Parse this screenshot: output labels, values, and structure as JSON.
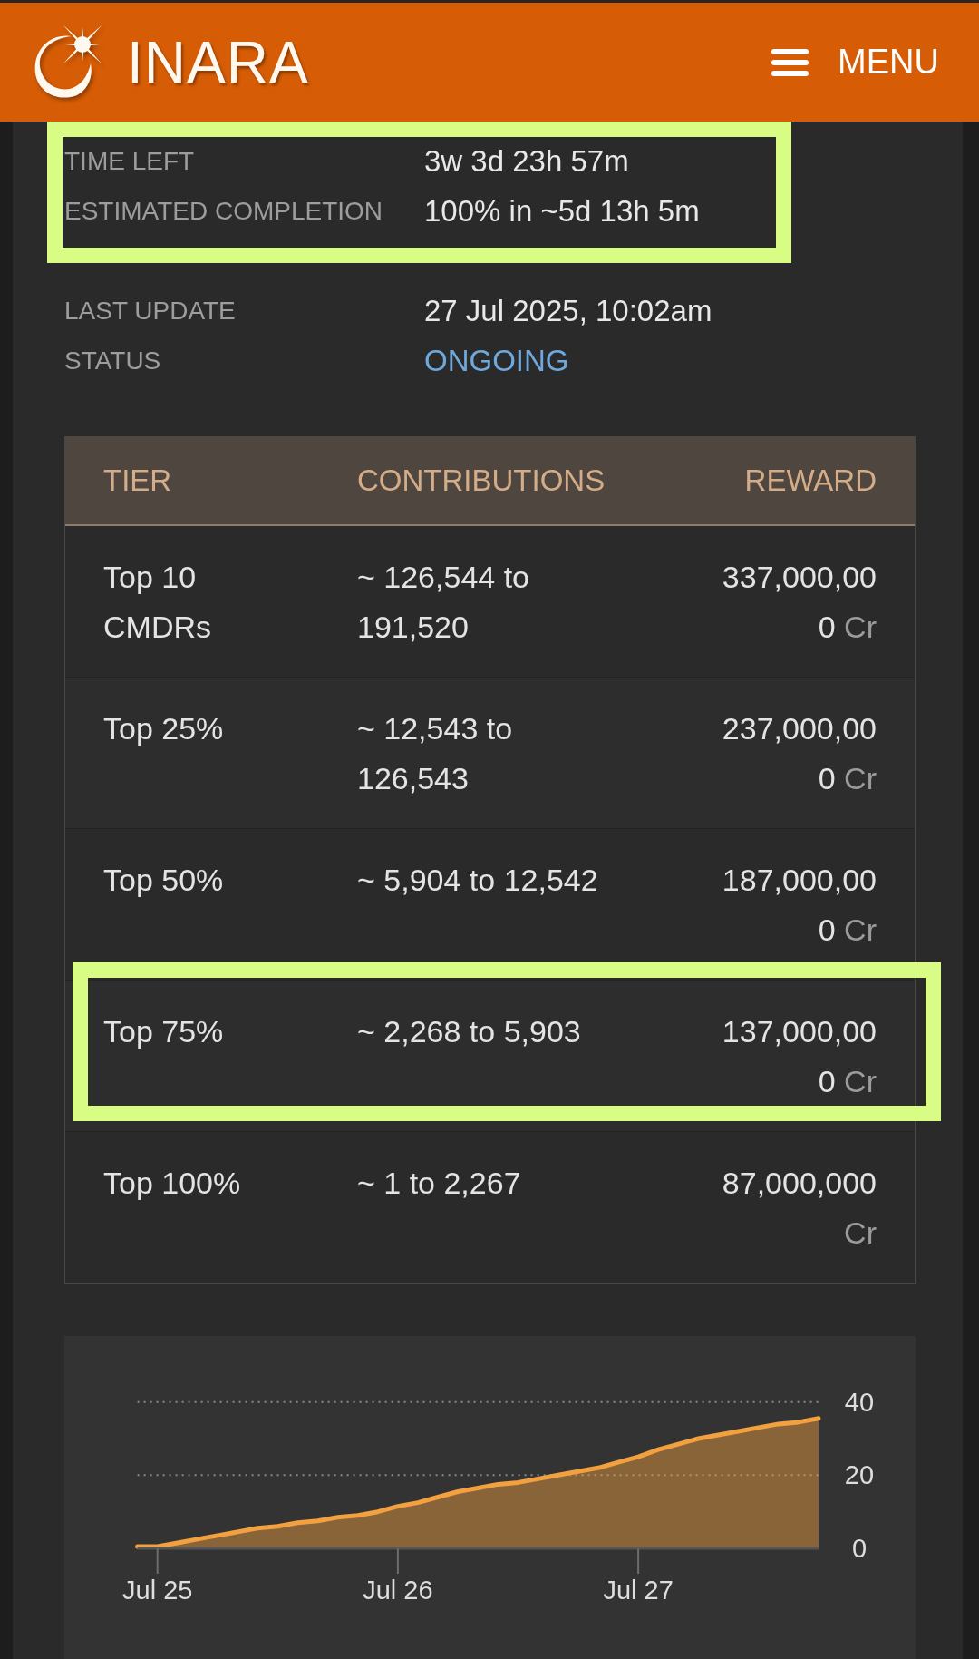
{
  "header": {
    "logo_text": "INARA",
    "menu_label": "MENU"
  },
  "info_groups": [
    {
      "highlighted": true,
      "rows": [
        {
          "label": "TIME LEFT",
          "value": "3w 3d 23h 57m",
          "kind": "text"
        },
        {
          "label": "ESTIMATED COMPLETION",
          "value": "100% in ~5d 13h 5m",
          "kind": "text"
        }
      ]
    },
    {
      "highlighted": false,
      "rows": [
        {
          "label": "LAST UPDATE",
          "value": "27 Jul 2025, 10:02am",
          "kind": "text"
        },
        {
          "label": "STATUS",
          "value": "ONGOING",
          "kind": "status"
        }
      ]
    }
  ],
  "tiers_table": {
    "columns": [
      "TIER",
      "CONTRIBUTIONS",
      "REWARD"
    ],
    "rows": [
      {
        "tier": "Top 10 CMDRs",
        "contributions": "~ 126,544 to 191,520",
        "reward": "337,000,000",
        "unit": "Cr",
        "highlighted": false
      },
      {
        "tier": "Top 25%",
        "contributions": "~ 12,543 to 126,543",
        "reward": "237,000,000",
        "unit": "Cr",
        "highlighted": false
      },
      {
        "tier": "Top 50%",
        "contributions": "~ 5,904 to 12,542",
        "reward": "187,000,000",
        "unit": "Cr",
        "highlighted": false
      },
      {
        "tier": "Top 75%",
        "contributions": "~ 2,268 to 5,903",
        "reward": "137,000,000",
        "unit": "Cr",
        "highlighted": true
      },
      {
        "tier": "Top 100%",
        "contributions": "~ 1 to 2,267",
        "reward": "87,000,000",
        "unit": "Cr",
        "highlighted": false
      }
    ]
  },
  "progress_chart": {
    "chart_data": {
      "type": "area",
      "categories": [
        null,
        "Jul 25",
        null,
        null,
        null,
        null,
        null,
        null,
        null,
        null,
        null,
        null,
        null,
        "Jul 26",
        null,
        null,
        null,
        null,
        null,
        null,
        null,
        null,
        null,
        null,
        null,
        "Jul 27",
        null,
        null,
        null,
        null,
        null,
        null,
        null,
        null,
        null
      ],
      "series": [
        {
          "color": "#f2a040",
          "values": [
            0.5,
            0.5,
            1.5,
            2.5,
            3.5,
            4.5,
            5.5,
            6,
            7,
            7.5,
            8.5,
            9,
            10,
            11.5,
            12.5,
            14,
            15.5,
            16.5,
            17.5,
            18,
            19,
            20,
            21,
            22,
            23.5,
            25,
            27,
            28.5,
            30,
            31,
            32,
            33,
            34,
            34.5,
            35.5
          ]
        }
      ],
      "ylim": [
        0,
        40
      ],
      "yticks": [
        0,
        20,
        40
      ]
    }
  }
}
